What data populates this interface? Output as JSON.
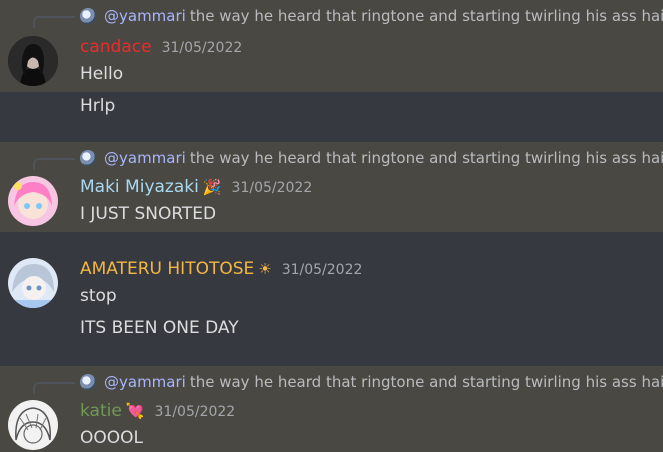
{
  "reply": {
    "user": "@yammari",
    "text": "the way he heard that ringtone and starting twirling his ass hair"
  },
  "messages": [
    {
      "author": "candace",
      "author_color": "#ed2b2b",
      "timestamp": "31/05/2022",
      "lines": [
        "Hello",
        "Hrlp"
      ]
    },
    {
      "author": "Maki Miyazaki",
      "author_color": "#a9d8f0",
      "badge": "🎉",
      "timestamp": "31/05/2022",
      "lines": [
        "I JUST SNORTED"
      ]
    },
    {
      "author": "AMATERU HITOTOSE",
      "author_color": "#f5b642",
      "badge": "☀",
      "timestamp": "31/05/2022",
      "lines": [
        "stop",
        "ITS BEEN ONE DAY"
      ]
    },
    {
      "author": "katie",
      "author_color": "#6f9a55",
      "badge": "💘",
      "timestamp": "31/05/2022",
      "lines": [
        "OOOOL"
      ]
    }
  ]
}
